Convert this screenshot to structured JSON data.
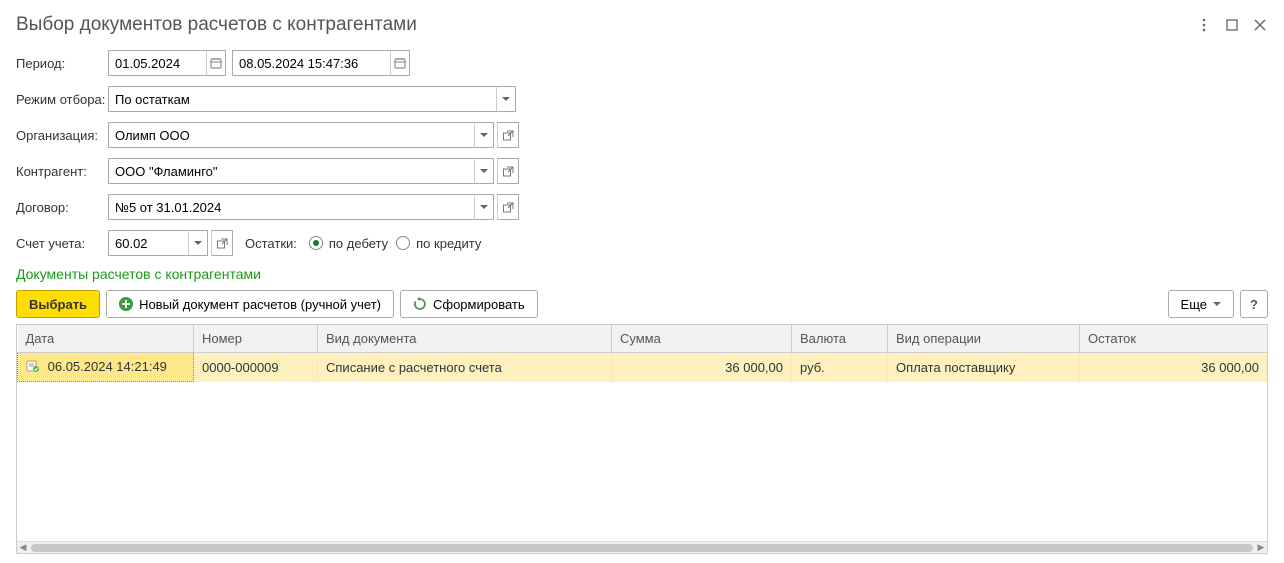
{
  "window": {
    "title": "Выбор документов расчетов с контрагентами"
  },
  "form": {
    "period_label": "Период:",
    "period_from": "01.05.2024",
    "period_to": "08.05.2024 15:47:36",
    "mode_label": "Режим отбора:",
    "mode_value": "По остаткам",
    "org_label": "Организация:",
    "org_value": "Олимп ООО",
    "counterparty_label": "Контрагент:",
    "counterparty_value": "ООО \"Фламинго\"",
    "contract_label": "Договор:",
    "contract_value": "№5 от 31.01.2024",
    "account_label": "Счет учета:",
    "account_value": "60.02",
    "balances_label": "Остатки:",
    "by_debit": "по дебету",
    "by_credit": "по кредиту"
  },
  "section_title": "Документы расчетов с контрагентами",
  "toolbar": {
    "select": "Выбрать",
    "new_doc": "Новый документ расчетов (ручной учет)",
    "generate": "Сформировать",
    "more": "Еще",
    "help": "?"
  },
  "table": {
    "headers": {
      "date": "Дата",
      "number": "Номер",
      "doc_type": "Вид документа",
      "sum": "Сумма",
      "currency": "Валюта",
      "op_type": "Вид операции",
      "balance": "Остаток"
    },
    "rows": [
      {
        "date": "06.05.2024 14:21:49",
        "number": "0000-000009",
        "doc_type": "Списание с расчетного счета",
        "sum": "36 000,00",
        "currency": "руб.",
        "op_type": "Оплата поставщику",
        "balance": "36 000,00"
      }
    ]
  }
}
